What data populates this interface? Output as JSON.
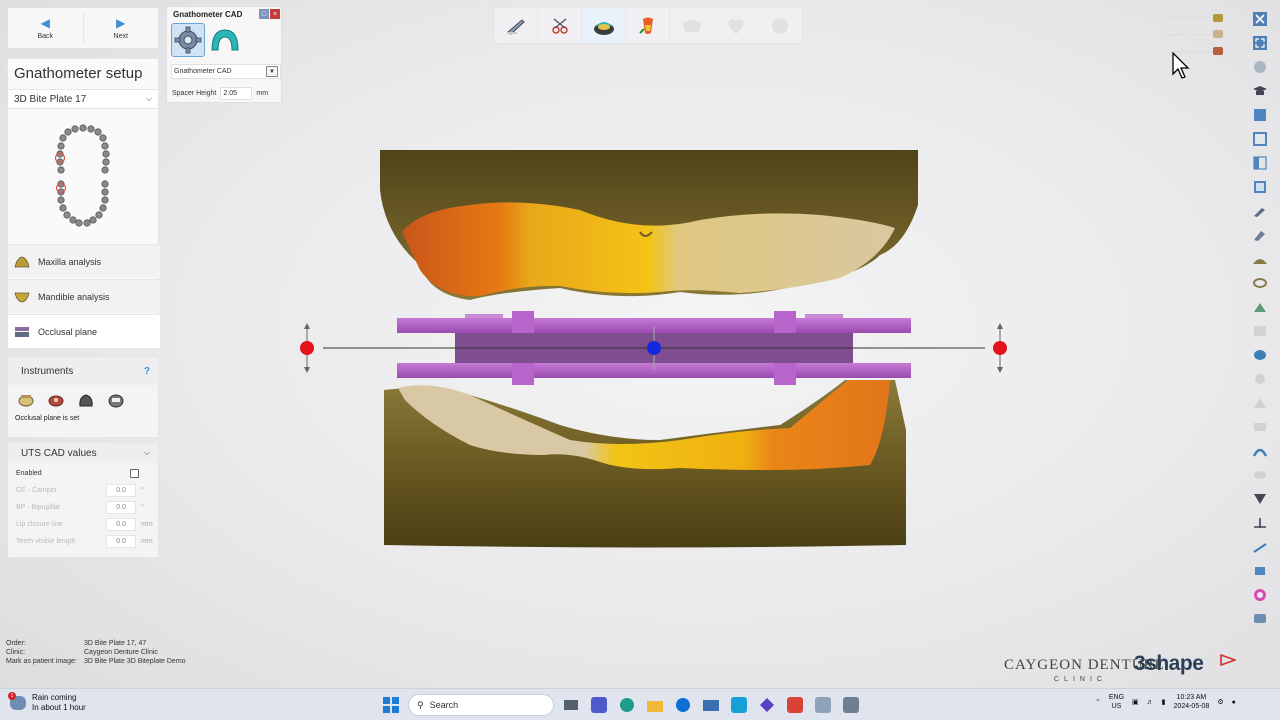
{
  "nav": {
    "back": "Back",
    "next": "Next"
  },
  "left": {
    "title": "Gnathometer setup",
    "plate_select": "3D Bite Plate 17",
    "analysis": [
      {
        "label": "Maxilla analysis"
      },
      {
        "label": "Mandible analysis"
      },
      {
        "label": "Occlusal plane"
      }
    ]
  },
  "instruments": {
    "title": "Instruments",
    "help": "?",
    "status": "Occlusal plane is set"
  },
  "uts": {
    "title": "UTS CAD values",
    "enabled_label": "Enabled",
    "rows": [
      {
        "label": "CE - Camper",
        "value": "0.0",
        "unit": "°"
      },
      {
        "label": "BP - Bipupillar",
        "value": "0.0",
        "unit": "°"
      },
      {
        "label": "Lip closure line",
        "value": "0.0",
        "unit": "mm"
      },
      {
        "label": "Teeth visible length",
        "value": "0.0",
        "unit": "mm"
      }
    ]
  },
  "cad": {
    "title": "Gnathometer CAD",
    "select": "Gnathometer CAD",
    "spacer_label": "Spacer Height",
    "spacer_value": "2.05",
    "spacer_unit": "mm"
  },
  "footer": {
    "order_label": "Order:",
    "order_value": "3D Bite Plate 17, 47",
    "clinic_label": "Clinic:",
    "clinic_value": "Caygeon Denture Clinic",
    "mark_label": "Mark as patient image:",
    "mark_value": "3D Bite Plate 3D Biteplate Demo"
  },
  "brand": {
    "clinic": "CAYGEON DENTURE",
    "clinic_sub": "CLINIC",
    "company": "3shape"
  },
  "taskbar": {
    "weather_title": "Rain coming",
    "weather_sub": "In about 1 hour",
    "weather_badge": "1",
    "search_placeholder": "Search",
    "lang_top": "ENG",
    "lang_bottom": "US",
    "time": "10:23 AM",
    "date": "2024-05-08"
  },
  "colors": {
    "accent": "#3d8ed6",
    "plate": "#b45ec8",
    "gum": "#6b5b27",
    "marker_red": "#e5131b",
    "marker_blue": "#1428e0"
  }
}
